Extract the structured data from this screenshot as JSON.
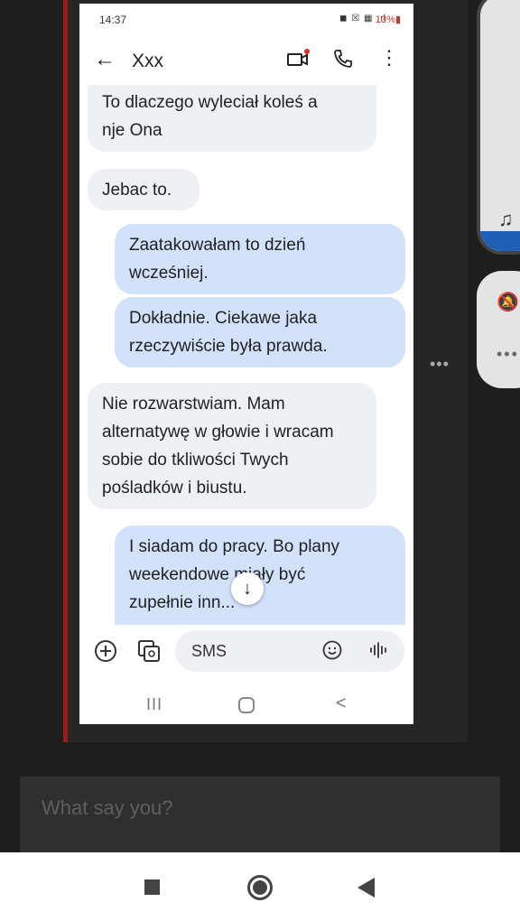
{
  "status_bar": {
    "time": "14:37",
    "icons": "◼ ☒ ▦ .ıl",
    "battery": "13%▮"
  },
  "conversation": {
    "back_icon": "arrow-left-icon",
    "contact_name": "Xxx",
    "actions": [
      "video-call-icon",
      "phone-icon",
      "more-vert-icon"
    ]
  },
  "messages": [
    {
      "direction": "incoming",
      "lines": [
        "To dlaczego wyleciał koleś a",
        "nje Ona"
      ]
    },
    {
      "direction": "incoming",
      "lines": [
        "Jebac to."
      ]
    },
    {
      "direction": "outgoing",
      "lines": [
        "Zaatakowałam to dzień",
        "wcześniej."
      ]
    },
    {
      "direction": "outgoing",
      "lines": [
        "Dokładnie. Ciekawe jaka",
        "rzeczywiście była prawda."
      ]
    },
    {
      "direction": "incoming",
      "lines": [
        "Nie rozwarstwiam. Mam",
        "alternatywę w głowie i wracam",
        "sobie do tkliwości Twych",
        "pośladków i biustu."
      ]
    },
    {
      "direction": "outgoing",
      "lines": [
        "I siadam do  pracy. Bo plany",
        "weekendowe miały być",
        "zupełnie inn..."
      ]
    }
  ],
  "scroll_down_icon": "↓",
  "composer": {
    "placeholder": "SMS"
  },
  "phone_nav": {
    "recents": "III",
    "back": "<"
  },
  "side_panel_dots": "•••",
  "reply_box": {
    "placeholder": "What say you?"
  },
  "colors": {
    "incoming_bubble": "#eef0f3",
    "outgoing_bubble": "#d3e2fb",
    "page_background": "#1e1e1e",
    "post_accent": "#9e1b1b"
  }
}
